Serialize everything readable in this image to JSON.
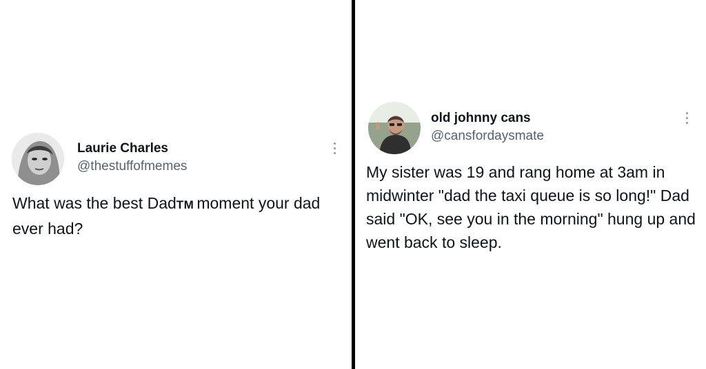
{
  "left_tweet": {
    "author_name": "Laurie Charles",
    "author_handle": "@thestuffofmemes",
    "text_before": "What was the best Dad",
    "trademark": "TM",
    "text_after": "moment your dad ever had?",
    "avatar_icon": "profile-photo",
    "more_icon": "vertical-ellipsis-icon"
  },
  "right_tweet": {
    "author_name": "old johnny cans",
    "author_handle": "@cansfordaysmate",
    "text": "My sister was 19 and rang home at 3am in midwinter \"dad the taxi queue is so long!\" Dad said \"OK, see you in the morning\" hung up and went back to sleep.",
    "avatar_icon": "profile-photo",
    "more_icon": "vertical-ellipsis-icon"
  },
  "colors": {
    "background": "#ffffff",
    "divider": "#000000",
    "text": "#0f1419",
    "secondary_text": "#536471"
  }
}
